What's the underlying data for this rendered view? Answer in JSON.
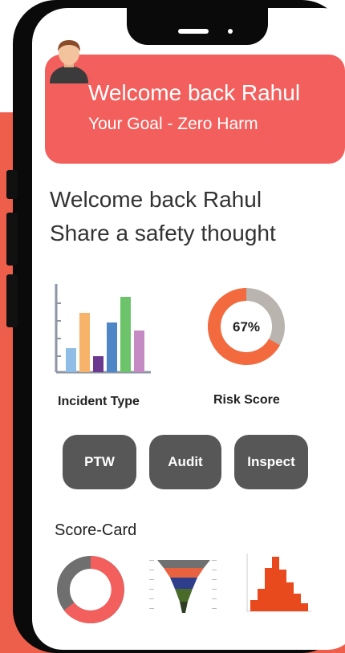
{
  "header": {
    "title": "Welcome back Rahul",
    "subtitle": "Your Goal - Zero Harm",
    "avatar_icon": "user-avatar-icon"
  },
  "greeting": {
    "line1": "Welcome back Rahul",
    "line2": "Share a safety thought"
  },
  "widgets": {
    "incident_type_label": "Incident Type",
    "risk_score_label": "Risk Score",
    "risk_score_value": "67%",
    "risk_score_fraction": 0.67
  },
  "actions": {
    "ptw": "PTW",
    "audit": "Audit",
    "inspect": "Inspect"
  },
  "scorecard": {
    "title": "Score-Card"
  },
  "colors": {
    "accent": "#f25f5c",
    "background_band": "#ee5f4b",
    "button": "#575757",
    "donut_orange": "#f26a3d",
    "donut_grey": "#b9b4ae"
  }
}
